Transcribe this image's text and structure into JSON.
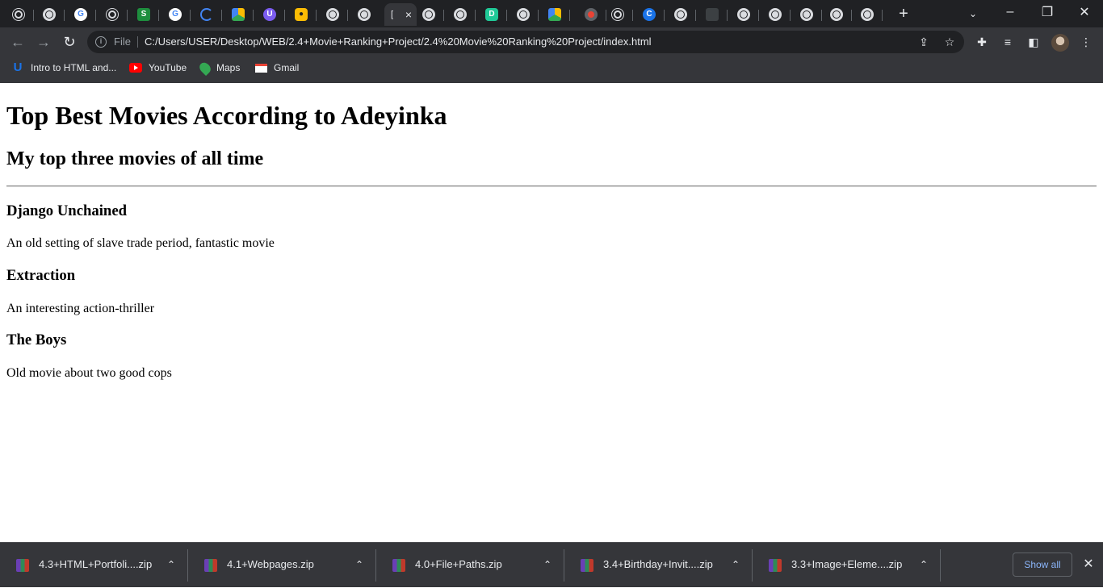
{
  "browser": {
    "active_tab": {
      "title": "[",
      "close_glyph": "×"
    },
    "tabs": [
      {
        "icon": "chrome-icon"
      },
      {
        "icon": "globe-icon"
      },
      {
        "icon": "google-icon"
      },
      {
        "icon": "chrome-icon"
      },
      {
        "icon": "s-app-icon"
      },
      {
        "icon": "google-icon"
      },
      {
        "icon": "loading-icon"
      },
      {
        "icon": "drive-icon"
      },
      {
        "icon": "u-app-icon"
      },
      {
        "icon": "yellow-app-icon"
      },
      {
        "icon": "globe-icon"
      },
      {
        "icon": "globe-icon"
      },
      {
        "icon": "active-tab"
      },
      {
        "icon": "globe-icon"
      },
      {
        "icon": "globe-icon"
      },
      {
        "icon": "d-app-icon"
      },
      {
        "icon": "globe-icon"
      },
      {
        "icon": "drive-icon"
      },
      {
        "icon": "record-icon"
      },
      {
        "icon": "chrome-icon"
      },
      {
        "icon": "c-app-icon"
      },
      {
        "icon": "globe-icon"
      },
      {
        "icon": "game-icon"
      },
      {
        "icon": "globe-icon"
      },
      {
        "icon": "globe-icon"
      },
      {
        "icon": "globe-icon"
      },
      {
        "icon": "globe-icon"
      },
      {
        "icon": "globe-icon"
      }
    ],
    "new_tab_glyph": "+",
    "window_controls": {
      "minimize": "–",
      "restore": "❐",
      "close": "✕"
    },
    "address_bar": {
      "scheme_label": "File",
      "url": "C:/Users/USER/Desktop/WEB/2.4+Movie+Ranking+Project/2.4%20Movie%20Ranking%20Project/index.html"
    },
    "bookmarks": [
      {
        "label": "Intro to HTML and...",
        "icon": "udemy-icon"
      },
      {
        "label": "YouTube",
        "icon": "youtube-icon"
      },
      {
        "label": "Maps",
        "icon": "maps-icon"
      },
      {
        "label": "Gmail",
        "icon": "gmail-icon"
      }
    ]
  },
  "page": {
    "title": "Top Best Movies According to Adeyinka",
    "subtitle": "My top three movies of all time",
    "movies": [
      {
        "title": "Django Unchained",
        "description": "An old setting of slave trade period, fantastic movie"
      },
      {
        "title": "Extraction",
        "description": "An interesting action-thriller"
      },
      {
        "title": "The Boys",
        "description": "Old movie about two good cops"
      }
    ]
  },
  "downloads": {
    "items": [
      {
        "name": "4.3+HTML+Portfoli....zip"
      },
      {
        "name": "4.1+Webpages.zip"
      },
      {
        "name": "4.0+File+Paths.zip"
      },
      {
        "name": "3.4+Birthday+Invit....zip"
      },
      {
        "name": "3.3+Image+Eleme....zip"
      }
    ],
    "show_all_label": "Show all",
    "close_glyph": "✕"
  },
  "colors": {
    "tabstrip": "#202124",
    "toolbar": "#35363a",
    "page_background": "#ffffff",
    "link_blue": "#8ab4f8"
  }
}
